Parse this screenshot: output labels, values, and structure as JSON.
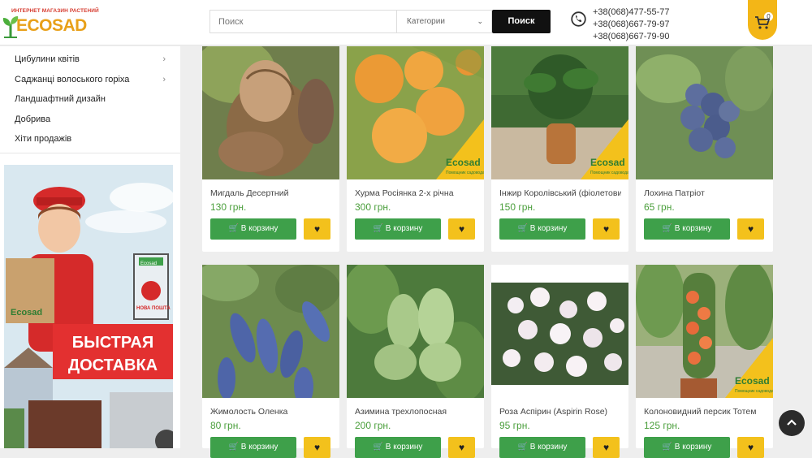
{
  "header": {
    "logo_tagline": "ИНТЕРНЕТ МАГАЗИН РАСТЕНИЙ",
    "logo_word": "ECOSAD",
    "search_placeholder": "Поиск",
    "category_label": "Категории",
    "search_button": "Поиск",
    "phones": [
      "+38(068)477-55-77",
      "+38(068)667-79-97",
      "+38(068)667-79-90"
    ],
    "cart_count": "0"
  },
  "sidebar": {
    "menu": [
      {
        "label": "Цибулини квітів",
        "has_arrow": true
      },
      {
        "label": "Саджанці волоського горіха",
        "has_arrow": true
      },
      {
        "label": "Ландшафтний дизайн",
        "has_arrow": false
      },
      {
        "label": "Добрива",
        "has_arrow": false
      },
      {
        "label": "Хіти продажів",
        "has_arrow": false
      }
    ],
    "banner": {
      "line1": "БЫСТРАЯ",
      "line2": "ДОСТАВКА",
      "brand": "Ecosad",
      "brand_sub": "Помощник садовода",
      "post": "НОВА ПОШТА"
    }
  },
  "products": [
    {
      "name": "Мигдаль Десертний",
      "price": "130 грн.",
      "buy": "В корзину"
    },
    {
      "name": "Хурма Росіянка 2-х річна",
      "price": "300 грн.",
      "buy": "В корзину"
    },
    {
      "name": "Інжир Королівський (фіолетовий)",
      "price": "150 грн.",
      "buy": "В корзину"
    },
    {
      "name": "Лохина Патріот",
      "price": "65 грн.",
      "buy": "В корзину"
    },
    {
      "name": "Жимолость Оленка",
      "price": "80 грн.",
      "buy": "В корзину"
    },
    {
      "name": "Азимина трехлопосная",
      "price": "200 грн.",
      "buy": "В корзину"
    },
    {
      "name": "Роза Аспірин (Aspirin Rose)",
      "price": "95 грн.",
      "buy": "В корзину"
    },
    {
      "name": "Колоновидний персик Тотем",
      "price": "125 грн.",
      "buy": "В корзину"
    }
  ],
  "watermark": "Ecosad",
  "watermark_sub": "Помощник садовода",
  "colors": {
    "accent_green": "#3ea04a",
    "accent_yellow": "#f3c11c",
    "price_green": "#4a9e3b"
  }
}
